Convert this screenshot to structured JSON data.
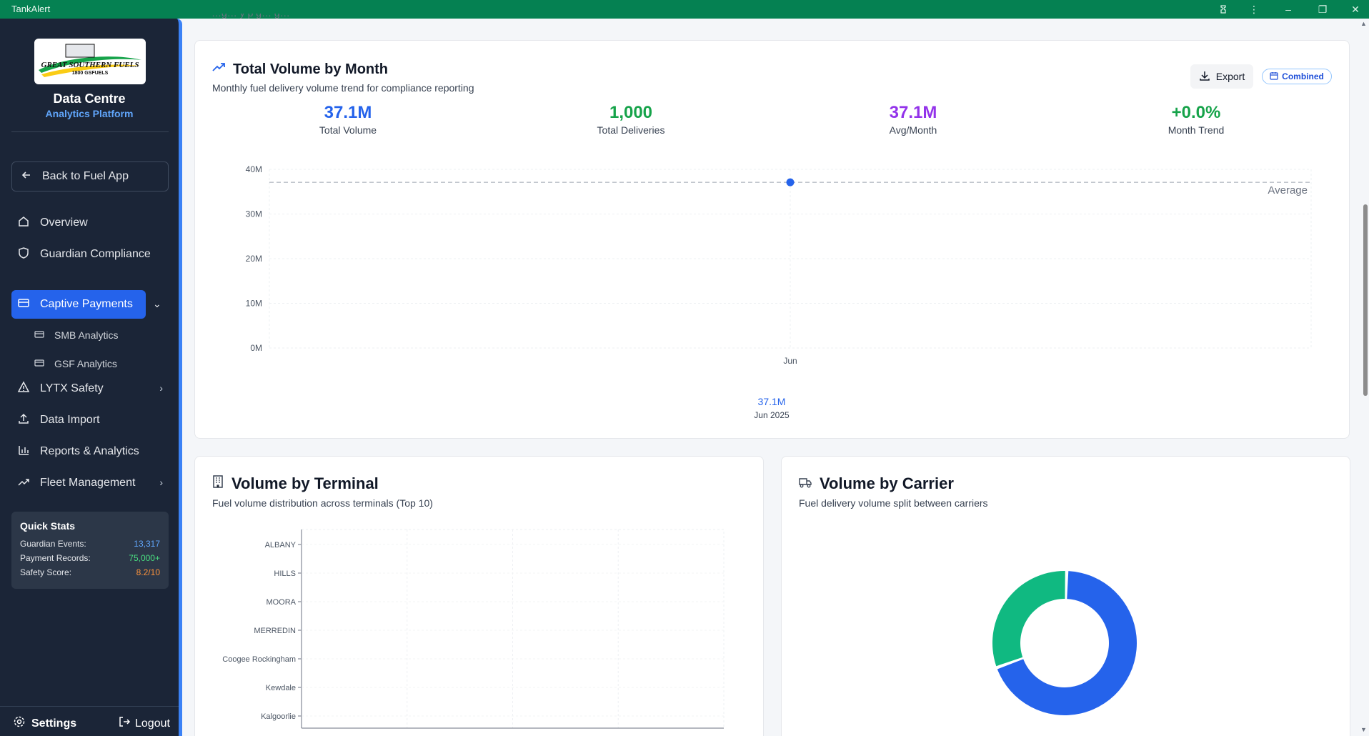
{
  "window": {
    "app_title": "TankAlert"
  },
  "sidebar": {
    "logo_text": "GREAT SOUTHERN FUELS",
    "logo_sub": "1800 GSFUELS",
    "title": "Data Centre",
    "subtitle": "Analytics Platform",
    "back_label": "Back to Fuel App",
    "nav": {
      "overview": "Overview",
      "guardian": "Guardian Compliance",
      "captive": "Captive Payments",
      "smb": "SMB Analytics",
      "gsf": "GSF Analytics",
      "lytx": "LYTX Safety",
      "import": "Data Import",
      "reports": "Reports & Analytics",
      "fleet": "Fleet Management"
    },
    "stats": {
      "title": "Quick Stats",
      "rows": [
        {
          "label": "Guardian Events:",
          "value": "13,317",
          "color": "#60a5fa"
        },
        {
          "label": "Payment Records:",
          "value": "75,000+",
          "color": "#4ade80"
        },
        {
          "label": "Safety Score:",
          "value": "8.2/10",
          "color": "#fb923c"
        }
      ]
    },
    "settings_label": "Settings",
    "logout_label": "Logout"
  },
  "header_partial": "…g… y  p   g…     g…",
  "volume_month": {
    "title": "Total Volume by Month",
    "subtitle": "Monthly fuel delivery volume trend for compliance reporting",
    "export_label": "Export",
    "combined_label": "Combined",
    "metrics": [
      {
        "value": "37.1M",
        "label": "Total Volume",
        "color": "#2563eb"
      },
      {
        "value": "1,000",
        "label": "Total Deliveries",
        "color": "#16a34a"
      },
      {
        "value": "37.1M",
        "label": "Avg/Month",
        "color": "#9333ea"
      },
      {
        "value": "+0.0%",
        "label": "Month Trend",
        "color": "#16a34a"
      }
    ],
    "average_label": "Average",
    "summary_value": "37.1M",
    "summary_label": "Jun 2025"
  },
  "terminal": {
    "title": "Volume by Terminal",
    "subtitle": "Fuel volume distribution across terminals (Top 10)"
  },
  "carrier": {
    "title": "Volume by Carrier",
    "subtitle": "Fuel delivery volume split between carriers"
  },
  "chart_data": [
    {
      "type": "line",
      "x": [
        "Jun"
      ],
      "series": [
        {
          "values": [
            37.1
          ]
        }
      ],
      "y_unit": "M",
      "ylim": [
        0,
        40
      ],
      "y_ticks": [
        "0M",
        "10M",
        "20M",
        "30M",
        "40M"
      ],
      "reference_line": {
        "label": "Average",
        "value": 37.1
      },
      "grid": true,
      "color": "#2563eb"
    },
    {
      "type": "bar",
      "orientation": "horizontal",
      "categories": [
        "ALBANY",
        "HILLS",
        "MOORA",
        "MERREDIN",
        "Coogee Rockingham",
        "Kewdale",
        "Kalgoorlie"
      ],
      "grid": true
    },
    {
      "type": "pie",
      "donut": true,
      "slices": [
        {
          "fraction": 0.69,
          "color": "#2563eb"
        },
        {
          "fraction": 0.31,
          "color": "#10b981"
        }
      ]
    }
  ]
}
